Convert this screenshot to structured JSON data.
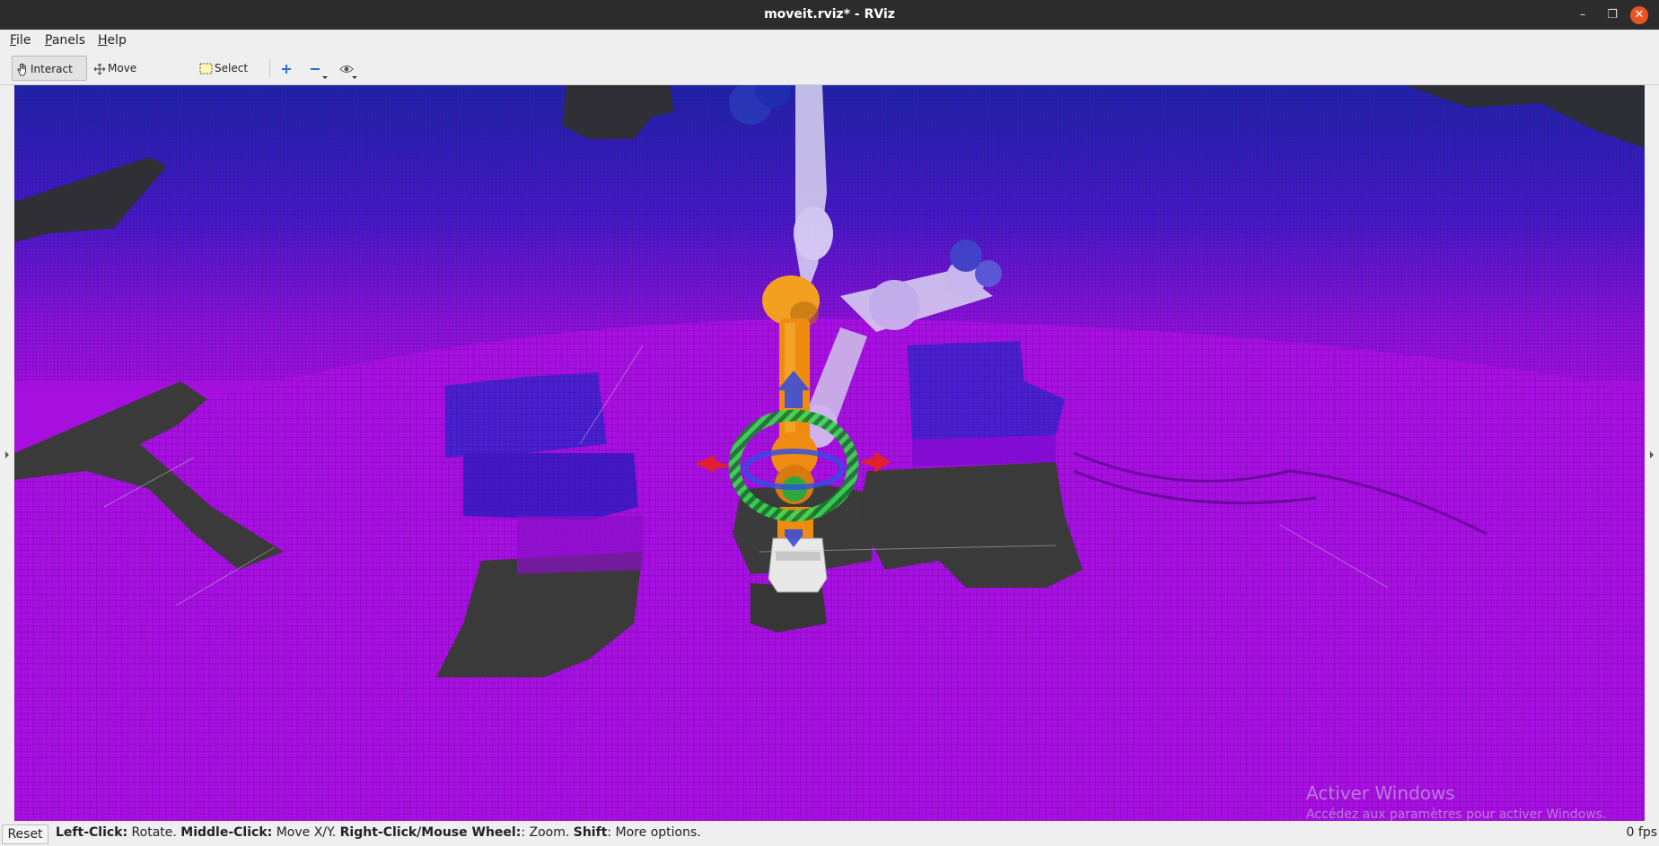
{
  "window": {
    "title": "moveit.rviz* - RViz",
    "minimize_glyph": "–",
    "maximize_glyph": "❐",
    "close_glyph": "✕"
  },
  "menubar": {
    "items": [
      {
        "label_first": "F",
        "label_rest": "ile"
      },
      {
        "label_first": "P",
        "label_rest": "anels"
      },
      {
        "label_first": "H",
        "label_rest": "elp"
      }
    ]
  },
  "toolbar": {
    "interact_label": "Interact",
    "move_camera_label": "Move Camera",
    "select_label": "Select",
    "icons": [
      "hand-icon",
      "move-camera-icon",
      "select-box-icon",
      "plus-icon",
      "minus-icon",
      "eye-icon"
    ],
    "active_tool": "Interact"
  },
  "viewport": {
    "colors": {
      "floor": "#a710e0",
      "floor_dark": "#7a06b0",
      "sky_top": "#1d1fa0",
      "obstacle": "#4a1fd0",
      "shadow": "#3a3a3a",
      "robot_orange": "#f08c12",
      "ghost_robot": "#d9d4f0",
      "ring_green": "#34d04a"
    },
    "watermark_line1": "Activer Windows",
    "watermark_line2": "Accédez aux paramètres pour activer Windows."
  },
  "statusbar": {
    "reset_label": "Reset",
    "hint_1_key": "Left-Click:",
    "hint_1_text": " Rotate. ",
    "hint_2_key": "Middle-Click:",
    "hint_2_text": " Move X/Y. ",
    "hint_3_key": "Right-Click/Mouse Wheel:",
    "hint_3_text": ": Zoom. ",
    "hint_4_key": "Shift",
    "hint_4_text": ": More options.",
    "fps": "0 fps"
  }
}
